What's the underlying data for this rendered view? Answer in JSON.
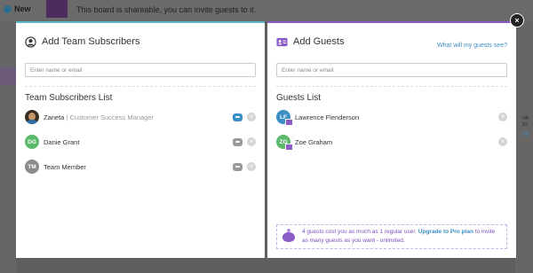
{
  "background": {
    "new_label": "New",
    "banner_text": "This board is shareable, you can invite guests to it.",
    "right_text_1": "nk to",
    "right_text_2": "ce"
  },
  "subscribers": {
    "title": "Add Team Subscribers",
    "input_placeholder": "Enter name or email",
    "list_title": "Team Subscribers List",
    "members": [
      {
        "name": "Zaneta",
        "role": "| Customer Success Manager",
        "initials": ""
      },
      {
        "name": "Danie Grant",
        "role": "",
        "initials": "DG"
      },
      {
        "name": "Team Member",
        "role": "",
        "initials": "TM"
      }
    ]
  },
  "guests": {
    "title": "Add Guests",
    "link": "What will my guests see?",
    "input_placeholder": "Enter name or email",
    "list_title": "Guests List",
    "members": [
      {
        "name": "Lawrence Flenderson",
        "initials": "LF"
      },
      {
        "name": "Zoe Graham",
        "initials": "ZG"
      }
    ],
    "promo_text": "4 guests cost you as much as 1 regular user.",
    "promo_link": "Upgrade to Pro plan",
    "promo_suffix": "to invite as many guests as you want - unlimited."
  },
  "close_label": "×",
  "colors": {
    "subscribers_accent": "#56b8c8",
    "guests_accent": "#8b5cc8",
    "link": "#3b8fc7"
  }
}
